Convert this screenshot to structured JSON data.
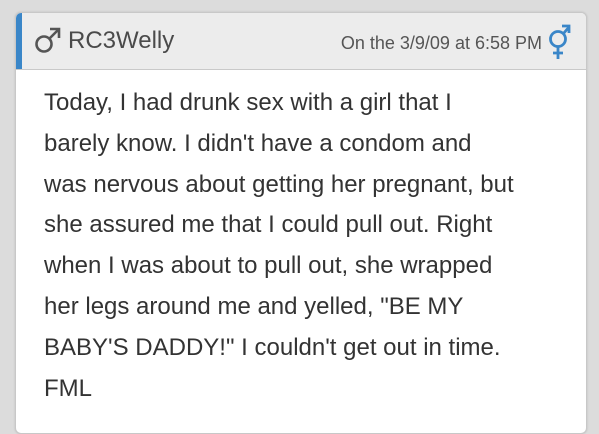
{
  "post": {
    "username": "RC3Welly",
    "timestamp": "On the 3/9/09 at 6:58 PM",
    "lines": [
      "Today, I had drunk sex with a girl that I",
      "barely know. I didn't have a condom and",
      "was nervous about getting her pregnant, but",
      "she assured me that I could pull out. Right",
      "when I was about to pull out, she wrapped",
      "her legs around me and yelled, \"BE MY",
      "BABY'S DADDY!\" I couldn't get out in time.",
      "FML"
    ]
  },
  "icons": {
    "author_gender": "male-symbol-icon",
    "corner": "male-female-symbol-icon"
  },
  "colors": {
    "accent": "#3a86c8",
    "male_symbol": "#555555",
    "header_bg": "#ececec",
    "text": "#333333"
  }
}
